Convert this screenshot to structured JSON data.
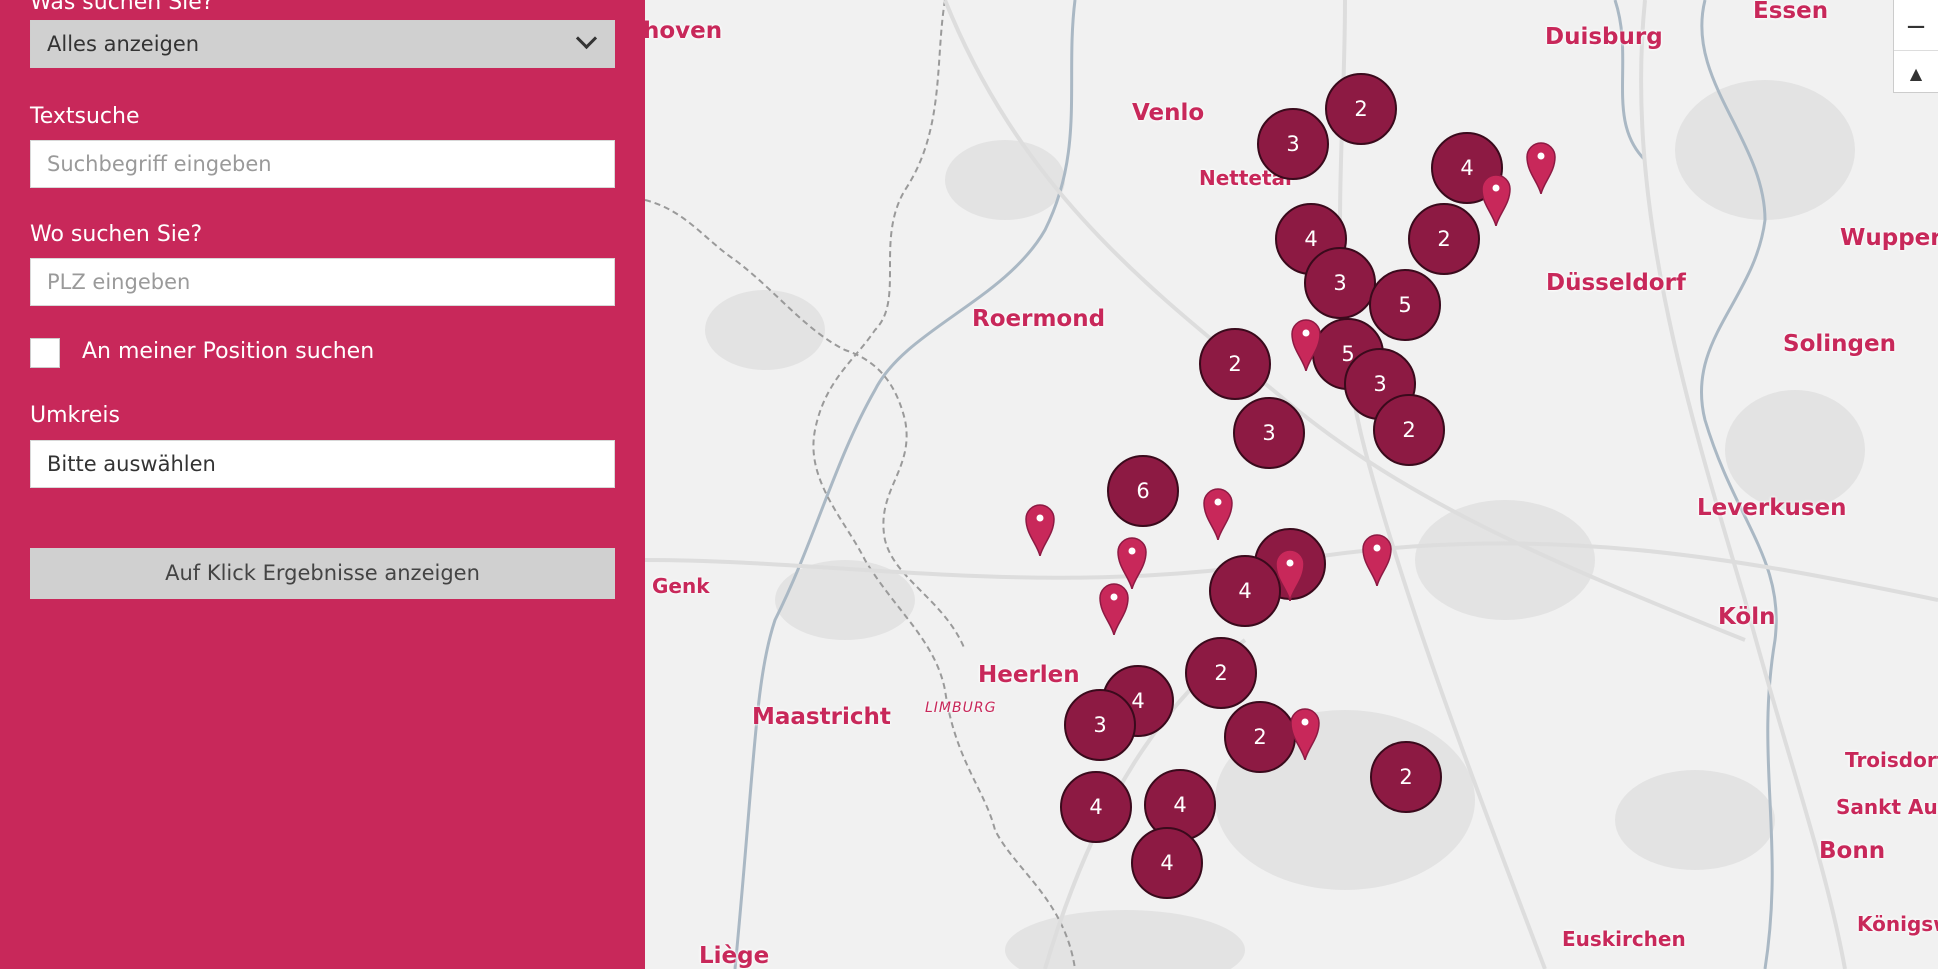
{
  "sidebar": {
    "what_label": "Was suchen Sie?",
    "what_value": "Alles anzeigen",
    "text_label": "Textsuche",
    "text_placeholder": "Suchbegriff eingeben",
    "where_label": "Wo suchen Sie?",
    "where_placeholder": "PLZ eingeben",
    "position_label": "An meiner Position suchen",
    "radius_label": "Umkreis",
    "radius_value": "Bitte auswählen",
    "submit_label": "Auf Klick Ergebnisse anzeigen"
  },
  "map": {
    "cities": [
      "hoven",
      "Essen",
      "Duisburg",
      "Venlo",
      "Nettetal",
      "Wupper",
      "Düsseldorf",
      "Roermond",
      "Solingen",
      "Leverkusen",
      "Genk",
      "Köln",
      "Heerlen",
      "Maastricht",
      "LIMBURG",
      "Troisdorf",
      "Sankt Aug",
      "Bonn",
      "Euskirchen",
      "Königsw",
      "Liège"
    ],
    "clusters": [
      "2",
      "3",
      "4",
      "2",
      "4",
      "3",
      "5",
      "5",
      "3",
      "2",
      "2",
      "3",
      "6",
      "4",
      "4",
      "2",
      "4",
      "3",
      "2",
      "2",
      "4",
      "4",
      "4"
    ],
    "zoom_out": "−",
    "reset_north": "▲",
    "accent_color": "#c8285a",
    "cluster_color": "#8d1a43"
  }
}
